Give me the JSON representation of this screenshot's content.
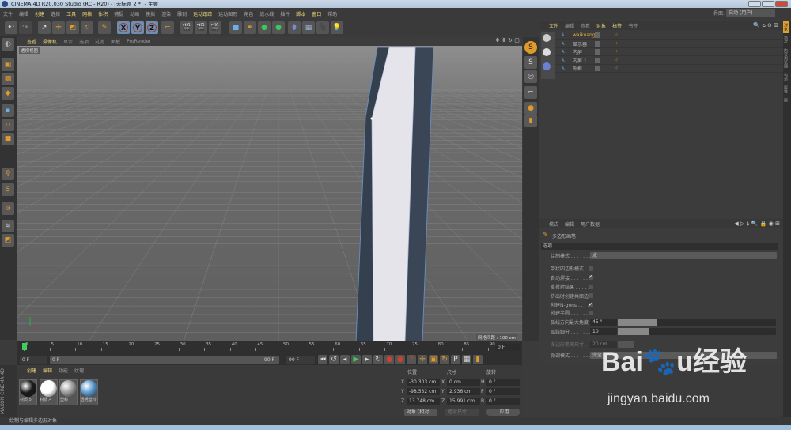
{
  "title": "CINEMA 4D R20.030 Studio (RC - R20) - [未标题 2 *] - 主要",
  "menu": [
    "文件",
    "编辑",
    "创建",
    "选择",
    "工具",
    "网格",
    "体积",
    "捕捉",
    "动画",
    "模拟",
    "渲染",
    "雕刻",
    "运动跟踪",
    "运动图形",
    "角色",
    "流水线",
    "插件",
    "脚本",
    "窗口",
    "帮助"
  ],
  "menu_highlight": [
    "创建",
    "工具",
    "网格",
    "体积",
    "运动跟踪",
    "脚本",
    "窗口"
  ],
  "layout_label": "界面:",
  "layout_value": "启动 (用户)",
  "viewport": {
    "menu": [
      "查看",
      "摄像机",
      "显示",
      "选项",
      "过滤",
      "面板",
      "ProRender"
    ],
    "label": "透视视图",
    "grid_spacing": "网格间距 : 100 cm"
  },
  "object_manager": {
    "menu": [
      "文件",
      "编辑",
      "查看",
      "对象",
      "标签",
      "书签"
    ],
    "objects": [
      "waikuang",
      "显示器",
      "内屏",
      "内屏.1",
      "外框"
    ],
    "selected": "waikuang"
  },
  "right_tabs": [
    "对象",
    "场次",
    "内容浏览器",
    "构造",
    "属性",
    "层"
  ],
  "attributes": {
    "menu": [
      "模式",
      "编辑",
      "用户数据"
    ],
    "tool_name": "多边形画笔",
    "section": "选项",
    "draw_mode_label": "绘制模式 . . . . . . .",
    "draw_mode_value": "点",
    "checks": [
      {
        "label": "带状四边形模式 .",
        "checked": false
      },
      {
        "label": "自动焊接 . . . . . . .",
        "checked": true
      },
      {
        "label": "重投射结果 . . . . .",
        "checked": false
      },
      {
        "label": "挤出时创建共面边",
        "checked": false
      },
      {
        "label": "创建N-gons . . . .",
        "checked": true
      }
    ],
    "create_semicircle": {
      "label": "创建半圆 . . . . . . .",
      "checked": false
    },
    "arc_angle": {
      "label": "弧线方向最大角度",
      "value": "45 °",
      "fraction": 0.25
    },
    "arc_subdiv": {
      "label": "弧线细分 . . . . . . .",
      "value": "10",
      "fraction": 0.2
    },
    "brush_size": {
      "label": "多边形笔刷尺寸 . .",
      "value": "20 cm"
    },
    "tweak_mode": {
      "label": "微调模式 . . . . . . .",
      "value": "完全"
    },
    "check_mark": "✔"
  },
  "timeline": {
    "ticks": [
      "0",
      "5",
      "10",
      "15",
      "20",
      "25",
      "30",
      "35",
      "40",
      "45",
      "50",
      "55",
      "60",
      "65",
      "70",
      "75",
      "80",
      "85",
      "90"
    ],
    "current_frame_field": "0 F",
    "start": "0 F",
    "range_start": "0 F",
    "range_end": "90 F",
    "end": "90 F"
  },
  "materials": {
    "menu": [
      "创建",
      "编辑",
      "功能",
      "纹理"
    ],
    "items": [
      {
        "name": "材质.5",
        "color": "#1a1a1a"
      },
      {
        "name": "材质.4",
        "color": "#ffffff"
      },
      {
        "name": "塑料",
        "color": "#9a9a9a"
      },
      {
        "name": "透明塑料",
        "color": "#5a9ad0"
      }
    ],
    "brand": "MAXON CINEMA 4D"
  },
  "coords": {
    "headers": [
      "位置",
      "尺寸",
      "旋转"
    ],
    "rows": [
      {
        "a": "X",
        "pos": "-30.303 cm",
        "b": "X",
        "size": "0 cm",
        "c": "H",
        "rot": "0 °"
      },
      {
        "a": "Y",
        "pos": "-98.532 cm",
        "b": "Y",
        "size": "2.936 cm",
        "c": "P",
        "rot": "0 °"
      },
      {
        "a": "Z",
        "pos": "13.748 cm",
        "b": "Z",
        "size": "15.991 cm",
        "c": "B",
        "rot": "0 °"
      }
    ],
    "mode": "对象 (相对)",
    "size_mode": "绝对尺寸",
    "apply": "应用"
  },
  "status": "绘制与编辑多边形对象",
  "watermark": "Baidu经验 jingyan.baidu.com"
}
